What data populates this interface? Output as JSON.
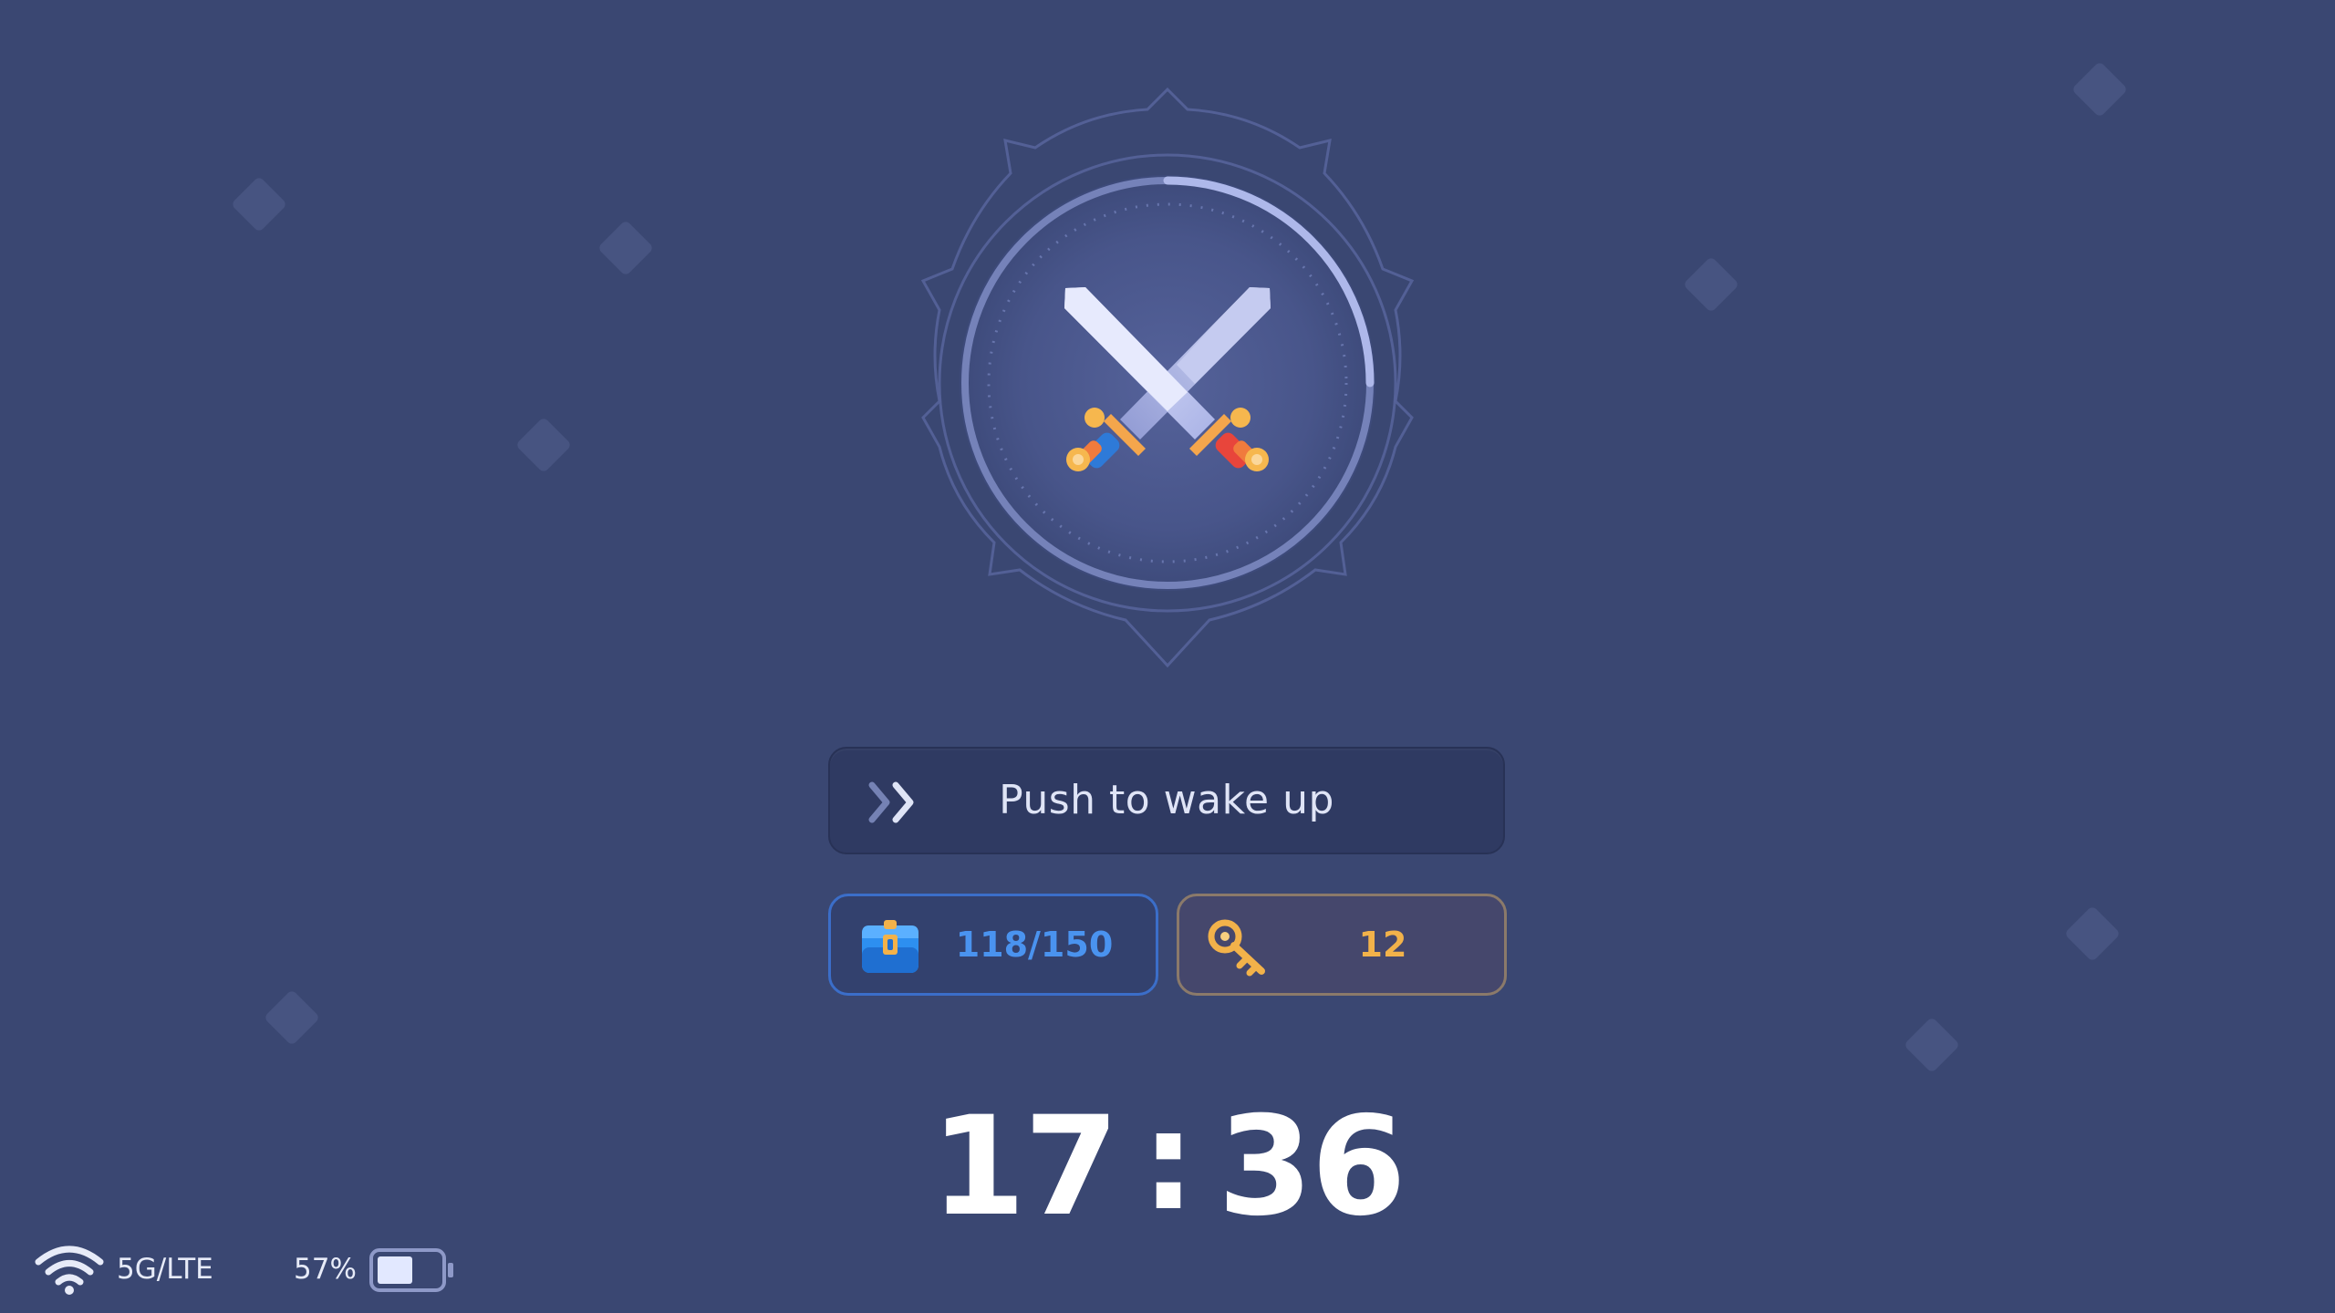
{
  "wake": {
    "label": "Push to wake up"
  },
  "inventory": {
    "icon": "backpack-icon",
    "value": "118/150"
  },
  "keys": {
    "icon": "key-icon",
    "value": "12"
  },
  "clock": {
    "hours": "17",
    "separator": ":",
    "minutes": "36"
  },
  "status": {
    "network": "5G/LTE",
    "battery_percent": "57%",
    "battery_level": 0.57
  },
  "emblem": {
    "icon": "crossed-swords-icon",
    "progress": 0.25
  },
  "colors": {
    "background": "#3a4772",
    "inventory_accent": "#4a93ef",
    "keys_accent": "#f2b24a",
    "text": "#ffffff"
  }
}
